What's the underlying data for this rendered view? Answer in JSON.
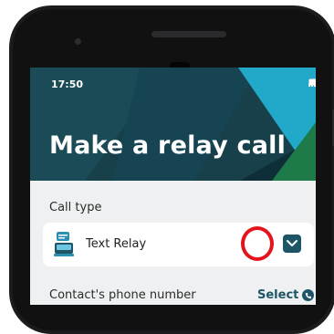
{
  "status_bar": {
    "time": "17:50",
    "icons": [
      "signal-icon",
      "wifi-icon",
      "battery-icon"
    ]
  },
  "header": {
    "title": "Make a relay call"
  },
  "call_type": {
    "label": "Call type",
    "selected": "Text Relay",
    "icon": "text-relay-icon",
    "dropdown_icon": "chevron-down-icon"
  },
  "contact": {
    "label": "Contact's phone number",
    "select_label": "Select",
    "select_icon": "phone-icon"
  },
  "colors": {
    "accent": "#1e5566",
    "hero_bg": "#17404b",
    "highlight": "#e3141c",
    "triangle_cyan": "#22a8c8",
    "triangle_green": "#1f7a4a"
  }
}
